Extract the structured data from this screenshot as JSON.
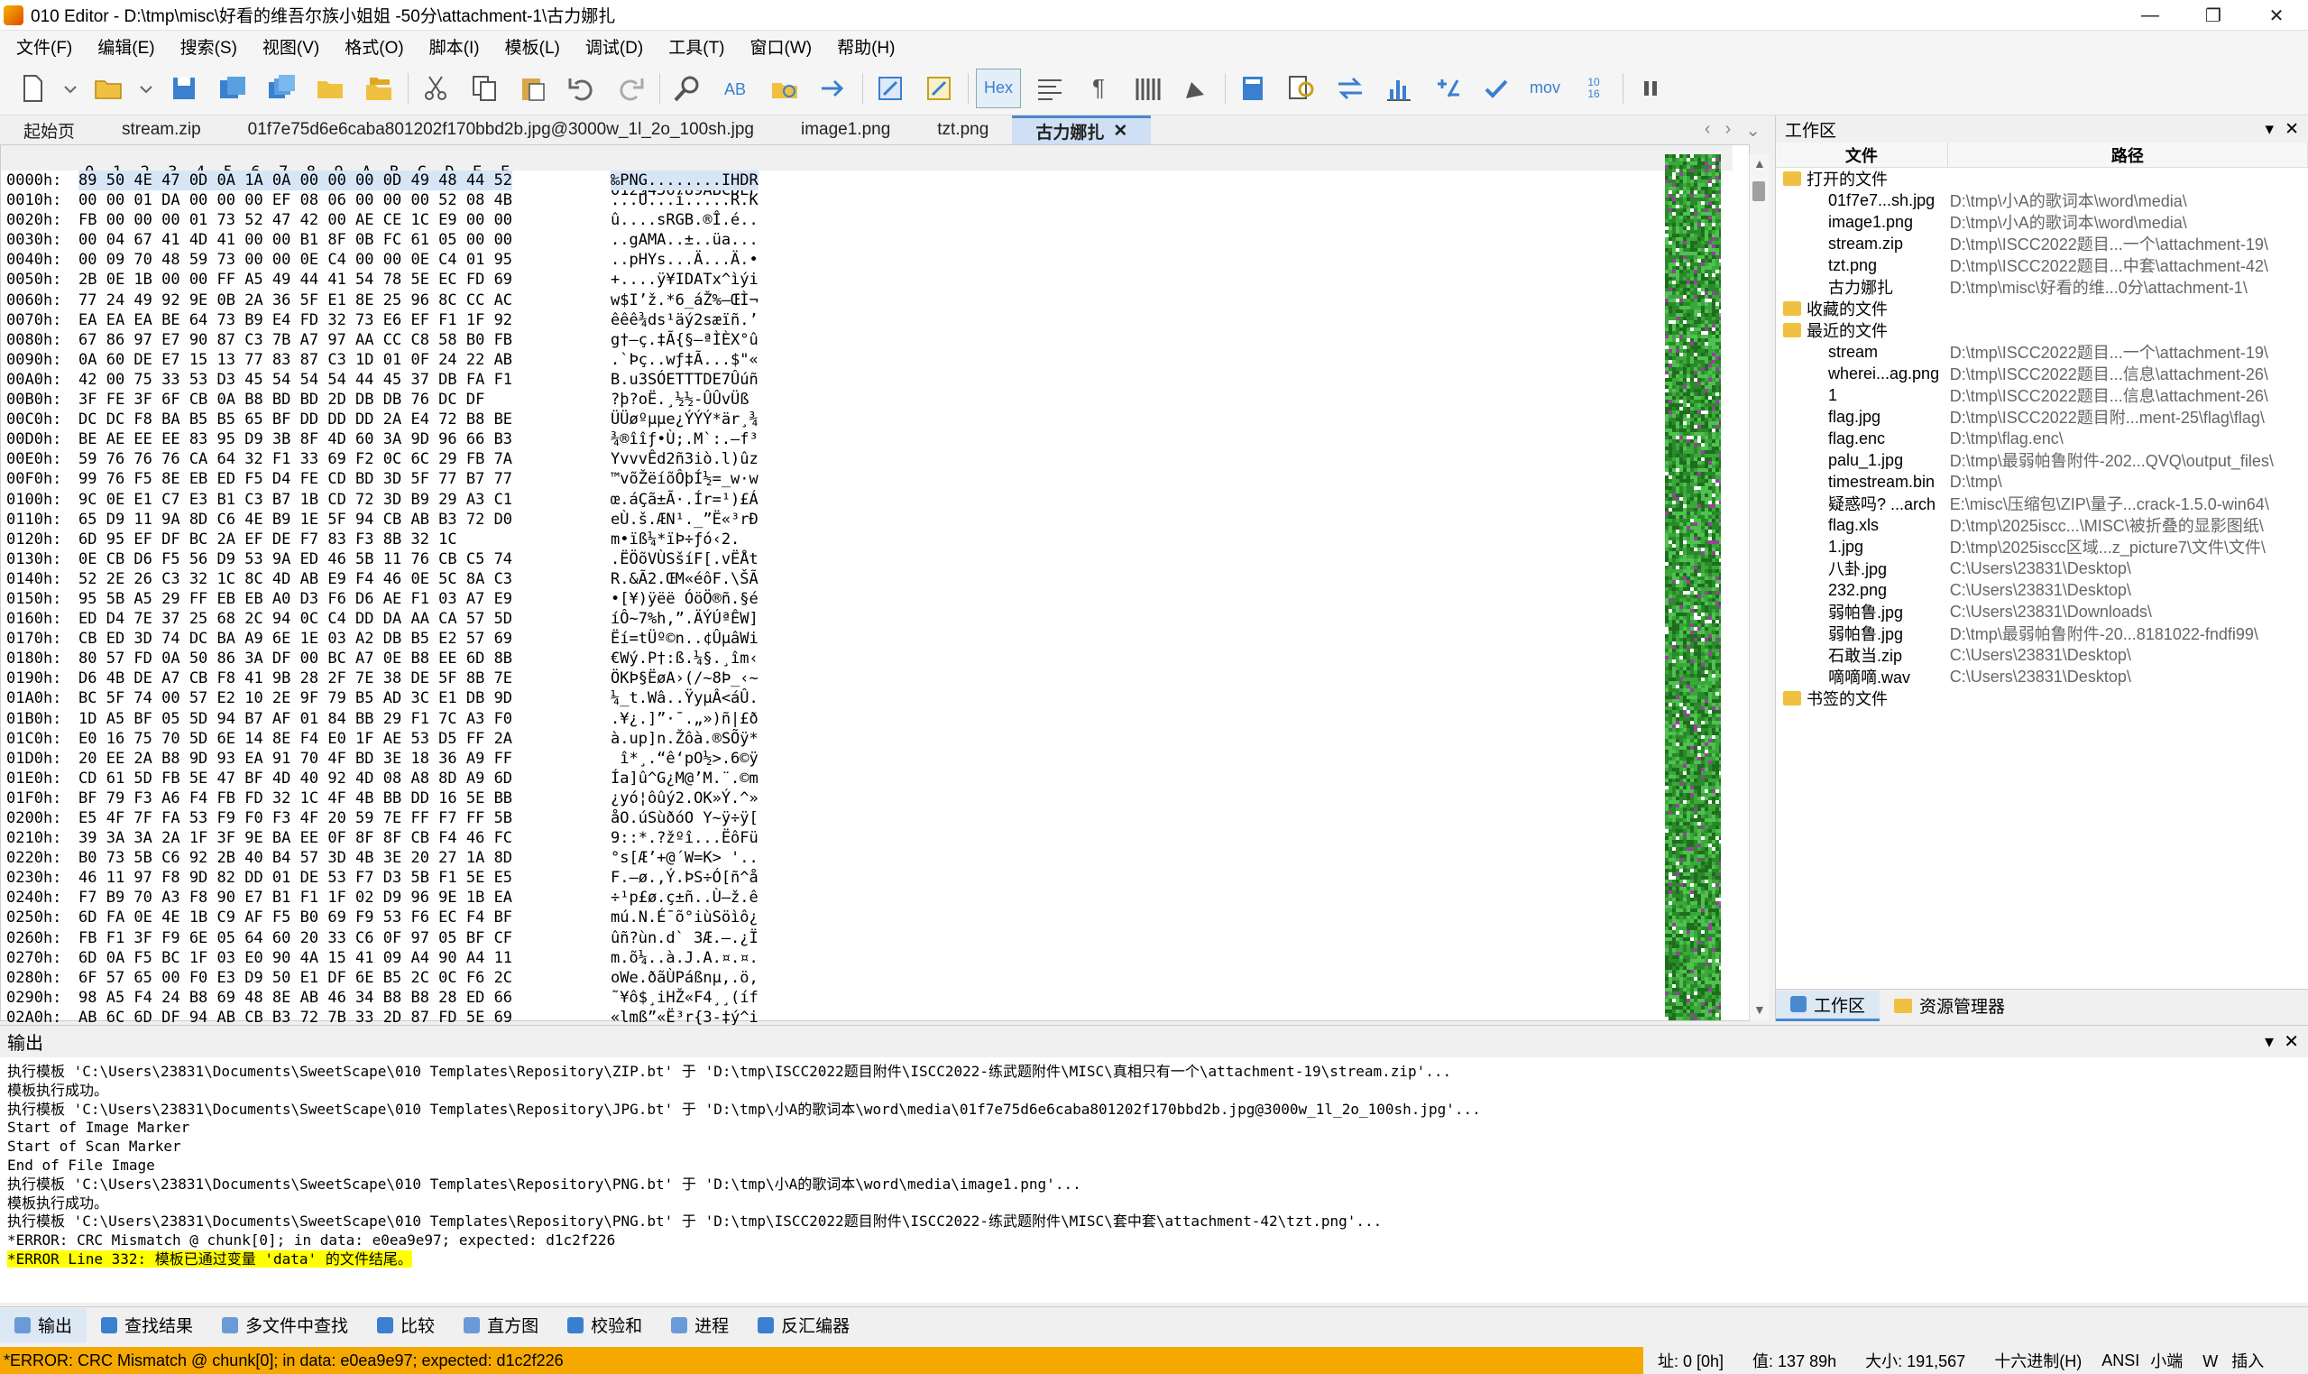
{
  "window": {
    "title": "010 Editor - D:\\tmp\\misc\\好看的维吾尔族小姐姐 -50分\\attachment-1\\古力娜扎"
  },
  "menu": [
    "文件(F)",
    "编辑(E)",
    "搜索(S)",
    "视图(V)",
    "格式(O)",
    "脚本(I)",
    "模板(L)",
    "调试(D)",
    "工具(T)",
    "窗口(W)",
    "帮助(H)"
  ],
  "toolbar": {
    "hex_label": "Hex",
    "mov_label": "mov",
    "num_label": "10 16"
  },
  "tabs": [
    "起始页",
    "stream.zip",
    "01f7e75d6e6caba801202f170bbd2b.jpg@3000w_1l_2o_100sh.jpg",
    "image1.png",
    "tzt.png",
    "古力娜扎"
  ],
  "active_tab": "古力娜扎",
  "hex": {
    "header_hex": "     0  1  2  3  4  5  6  7  8  9  A  B  C  D  E  F",
    "header_ascii": "0123456789ABCDEF",
    "rows": [
      {
        "o": "0000h:",
        "h": "89 50 4E 47 0D 0A 1A 0A 00 00 00 0D 49 48 44 52",
        "a": "‰PNG........IHDR"
      },
      {
        "o": "0010h:",
        "h": "00 00 01 DA 00 00 00 EF 08 06 00 00 00 52 08 4B",
        "a": "...Ú...ï.....R.K"
      },
      {
        "o": "0020h:",
        "h": "FB 00 00 00 01 73 52 47 42 00 AE CE 1C E9 00 00",
        "a": "û....sRGB.®Î.é.."
      },
      {
        "o": "0030h:",
        "h": "00 04 67 41 4D 41 00 00 B1 8F 0B FC 61 05 00 00",
        "a": "..gAMA..±..üa..."
      },
      {
        "o": "0040h:",
        "h": "00 09 70 48 59 73 00 00 0E C4 00 00 0E C4 01 95",
        "a": "..pHYs...Ä...Ä.•"
      },
      {
        "o": "0050h:",
        "h": "2B 0E 1B 00 00 FF A5 49 44 41 54 78 5E EC FD 69",
        "a": "+....ÿ¥IDATx^ìýi"
      },
      {
        "o": "0060h:",
        "h": "77 24 49 92 9E 0B 2A 36 5F E1 8E 25 96 8C CC AC",
        "a": "w$I’ž.*6_áŽ%–ŒÌ¬"
      },
      {
        "o": "0070h:",
        "h": "EA EA EA BE 64 73 B9 E4 FD 32 73 E6 EF F1 1F 92",
        "a": "êêê¾ds¹äý2sæïñ.’"
      },
      {
        "o": "0080h:",
        "h": "67 86 97 E7 90 87 C3 7B A7 97 AA CC C8 58 B0 FB",
        "a": "g†—ç.‡Ã{§—ªÌÈX°û"
      },
      {
        "o": "0090h:",
        "h": "0A 60 DE E7 15 13 77 83 87 C3 1D 01 0F 24 22 AB",
        "a": ".`Þç..wƒ‡Ã...$\"«"
      },
      {
        "o": "00A0h:",
        "h": "42 00 75 33 53 D3 45 54 54 54 44 45 37 DB FA F1",
        "a": "B.u3SÓETTTDE7Ûúñ"
      },
      {
        "o": "00B0h:",
        "h": "3F FE 3F 6F CB 0A B8 BD BD 2D DB DB 76 DC DF",
        "a": "?þ?oË.¸½½-ÛÛvÜß"
      },
      {
        "o": "00C0h:",
        "h": "DC DC F8 BA B5 B5 65 BF DD DD DD 2A E4 72 B8 BE",
        "a": "ÜÜøºµµe¿ÝÝÝ*är¸¾"
      },
      {
        "o": "00D0h:",
        "h": "BE AE EE EE 83 95 D9 3B 8F 4D 60 3A 9D 96 66 B3",
        "a": "¾®îîƒ•Ù;.M`:.–f³"
      },
      {
        "o": "00E0h:",
        "h": "59 76 76 76 CA 64 32 F1 33 69 F2 0C 6C 29 FB 7A",
        "a": "YvvvÊd2ñ3iò.l)ûz"
      },
      {
        "o": "00F0h:",
        "h": "99 76 F5 8E EB ED F5 D4 FE CD BD 3D 5F 77 B7 77",
        "a": "™võŽëíõÔþÍ½=_w·w"
      },
      {
        "o": "0100h:",
        "h": "9C 0E E1 C7 E3 B1 C3 B7 1B CD 72 3D B9 29 A3 C1",
        "a": "œ.áÇã±Ã·.Ír=¹)£Á"
      },
      {
        "o": "0110h:",
        "h": "65 D9 11 9A 8D C6 4E B9 1E 5F 94 CB AB B3 72 D0",
        "a": "eÙ.š.ÆN¹._”Ë«³rÐ"
      },
      {
        "o": "0120h:",
        "h": "6D 95 EF DF BC 2A EF DE F7 83 F3 8B 32 1C",
        "a": "m•ïß¼*ïÞ÷ƒó‹2."
      },
      {
        "o": "0130h:",
        "h": "0E CB D6 F5 56 D9 53 9A ED 46 5B 11 76 CB C5 74",
        "a": ".ËÖõVÙSšíF[.vËÅt"
      },
      {
        "o": "0140h:",
        "h": "52 2E 26 C3 32 1C 8C 4D AB E9 F4 46 0E 5C 8A C3",
        "a": "R.&Ã2.ŒM«éôF.\\ŠÃ"
      },
      {
        "o": "0150h:",
        "h": "95 5B A5 29 FF EB EB A0 D3 F6 D6 AE F1 03 A7 E9",
        "a": "•[¥)ÿëë ÓöÖ®ñ.§é"
      },
      {
        "o": "0160h:",
        "h": "ED D4 7E 37 25 68 2C 94 0C C4 DD DA AA CA 57 5D",
        "a": "íÔ~7%h,”.ÄÝÚªÊW]"
      },
      {
        "o": "0170h:",
        "h": "CB ED 3D 74 DC BA A9 6E 1E 03 A2 DB B5 E2 57 69",
        "a": "Ëí=tÜº©n..¢ÛµâWi"
      },
      {
        "o": "0180h:",
        "h": "80 57 FD 0A 50 86 3A DF 00 BC A7 0E B8 EE 6D 8B",
        "a": "€Wý.P†:ß.¼§.¸îm‹"
      },
      {
        "o": "0190h:",
        "h": "D6 4B DE A7 CB F8 41 9B 28 2F 7E 38 DE 5F 8B 7E",
        "a": "ÖKÞ§ËøA›(/~8Þ_‹~"
      },
      {
        "o": "01A0h:",
        "h": "BC 5F 74 00 57 E2 10 2E 9F 79 B5 AD 3C E1 DB 9D",
        "a": "¼_t.Wâ..ŸyµÂ<áÛ."
      },
      {
        "o": "01B0h:",
        "h": "1D A5 BF 05 5D 94 B7 AF 01 84 BB 29 F1 7C A3 F0",
        "a": ".¥¿.]”·¯.„»)ñ|£ð"
      },
      {
        "o": "01C0h:",
        "h": "E0 16 75 70 5D 6E 14 8E F4 E0 1F AE 53 D5 FF 2A",
        "a": "à.up]n.Žôà.®SÕÿ*"
      },
      {
        "o": "01D0h:",
        "h": "20 EE 2A B8 9D 93 EA 91 70 4F BD 3E 18 36 A9 FF",
        "a": " î*¸.“ê‘pO½>.6©ÿ"
      },
      {
        "o": "01E0h:",
        "h": "CD 61 5D FB 5E 47 BF 4D 40 92 4D 08 A8 8D A9 6D",
        "a": "Ía]û^G¿M@’M.¨.©m"
      },
      {
        "o": "01F0h:",
        "h": "BF 79 F3 A6 F4 FB FD 32 1C 4F 4B BB DD 16 5E BB",
        "a": "¿yó¦ôûý2.OK»Ý.^»"
      },
      {
        "o": "0200h:",
        "h": "E5 4F 7F FA 53 F9 F0 F3 4F 20 59 7E FF F7 FF 5B",
        "a": "åO.úSùðóO Y~ÿ÷ÿ["
      },
      {
        "o": "0210h:",
        "h": "39 3A 3A 2A 1F 3F 9E BA EE 0F 8F 8F CB F4 46 FC",
        "a": "9::*.?žºî...ËôFü"
      },
      {
        "o": "0220h:",
        "h": "B0 73 5B C6 92 2B 40 B4 57 3D 4B 3E 20 27 1A 8D",
        "a": "°s[Æ’+@´W=K> '.."
      },
      {
        "o": "0230h:",
        "h": "46 11 97 F8 9D 82 DD 01 DE 53 F7 D3 5B F1 5E E5",
        "a": "F.—ø.‚Ý.ÞS÷Ó[ñ^å"
      },
      {
        "o": "0240h:",
        "h": "F7 B9 70 A3 F8 90 E7 B1 F1 1F 02 D9 96 9E 1B EA",
        "a": "÷¹p£ø.ç±ñ..Ù–ž.ê"
      },
      {
        "o": "0250h:",
        "h": "6D FA 0E 4E 1B C9 AF F5 B0 69 F9 53 F6 EC F4 BF",
        "a": "mú.N.É¯õ°iùSöìô¿"
      },
      {
        "o": "0260h:",
        "h": "FB F1 3F F9 6E 05 64 60 20 33 C6 0F 97 05 BF CF",
        "a": "ûñ?ùn.d` 3Æ.—.¿Ï"
      },
      {
        "o": "0270h:",
        "h": "6D 0A F5 BC 1F 03 E0 90 4A 15 41 09 A4 90 A4 11",
        "a": "m.õ¼..à.J.A.¤.¤."
      },
      {
        "o": "0280h:",
        "h": "6F 57 65 00 F0 E3 D9 50 E1 DF 6E B5 2C 0C F6 2C",
        "a": "oWe.ðãÙPáßnµ,.ö,"
      },
      {
        "o": "0290h:",
        "h": "98 A5 F4 24 B8 69 48 8E AB 46 34 B8 B8 28 ED 66",
        "a": "˜¥ô$¸iHŽ«F4¸¸(íf"
      },
      {
        "o": "02A0h:",
        "h": "AB 6C 6D DF 94 AB CB B3 72 7B 33 2D 87 FD 5E 69",
        "a": "«lmß”«Ë³r{3-‡ý^i"
      }
    ]
  },
  "workspace": {
    "title": "工作区",
    "col_file": "文件",
    "col_path": "路径",
    "groups": [
      {
        "label": "打开的文件",
        "items": [
          {
            "name": "01f7e7...sh.jpg",
            "path": "D:\\tmp\\小A的歌词本\\word\\media\\"
          },
          {
            "name": "image1.png",
            "path": "D:\\tmp\\小A的歌词本\\word\\media\\"
          },
          {
            "name": "stream.zip",
            "path": "D:\\tmp\\ISCC2022题目...一个\\attachment-19\\"
          },
          {
            "name": "tzt.png",
            "path": "D:\\tmp\\ISCC2022题目...中套\\attachment-42\\"
          },
          {
            "name": "古力娜扎",
            "path": "D:\\tmp\\misc\\好看的维...0分\\attachment-1\\"
          }
        ]
      },
      {
        "label": "收藏的文件",
        "items": []
      },
      {
        "label": "最近的文件",
        "items": [
          {
            "name": "stream",
            "path": "D:\\tmp\\ISCC2022题目...一个\\attachment-19\\"
          },
          {
            "name": "wherei...ag.png",
            "path": "D:\\tmp\\ISCC2022题目...信息\\attachment-26\\"
          },
          {
            "name": "1",
            "path": "D:\\tmp\\ISCC2022题目...信息\\attachment-26\\"
          },
          {
            "name": "flag.jpg",
            "path": "D:\\tmp\\ISCC2022题目附...ment-25\\flag\\flag\\"
          },
          {
            "name": "flag.enc",
            "path": "D:\\tmp\\flag.enc\\"
          },
          {
            "name": "palu_1.jpg",
            "path": "D:\\tmp\\最弱帕鲁附件-202...QVQ\\output_files\\"
          },
          {
            "name": "timestream.bin",
            "path": "D:\\tmp\\"
          },
          {
            "name": "疑惑吗? ...arch",
            "path": "E:\\misc\\压缩包\\ZIP\\量子...crack-1.5.0-win64\\"
          },
          {
            "name": "flag.xls",
            "path": "D:\\tmp\\2025iscc...\\MISC\\被折叠的显影图纸\\"
          },
          {
            "name": "1.jpg",
            "path": "D:\\tmp\\2025iscc区域...z_picture7\\文件\\文件\\"
          },
          {
            "name": "八卦.jpg",
            "path": "C:\\Users\\23831\\Desktop\\"
          },
          {
            "name": "232.png",
            "path": "C:\\Users\\23831\\Desktop\\"
          },
          {
            "name": "弱帕鲁.jpg",
            "path": "C:\\Users\\23831\\Downloads\\"
          },
          {
            "name": "弱帕鲁.jpg",
            "path": "D:\\tmp\\最弱帕鲁附件-20...8181022-fndfi99\\"
          },
          {
            "name": "石敢当.zip",
            "path": "C:\\Users\\23831\\Desktop\\"
          },
          {
            "name": "嘀嘀嘀.wav",
            "path": "C:\\Users\\23831\\Desktop\\"
          }
        ]
      },
      {
        "label": "书签的文件",
        "items": []
      }
    ],
    "tabs": [
      "工作区",
      "资源管理器"
    ]
  },
  "output": {
    "title": "输出",
    "lines": [
      "执行模板 'C:\\Users\\23831\\Documents\\SweetScape\\010 Templates\\Repository\\ZIP.bt' 于 'D:\\tmp\\ISCC2022题目附件\\ISCC2022-练武题附件\\MISC\\真相只有一个\\attachment-19\\stream.zip'...",
      "模板执行成功。",
      "执行模板 'C:\\Users\\23831\\Documents\\SweetScape\\010 Templates\\Repository\\JPG.bt' 于 'D:\\tmp\\小A的歌词本\\word\\media\\01f7e75d6e6caba801202f170bbd2b.jpg@3000w_1l_2o_100sh.jpg'...",
      "Start of Image Marker",
      "Start of Scan Marker",
      "End of File Image",
      "执行模板 'C:\\Users\\23831\\Documents\\SweetScape\\010 Templates\\Repository\\PNG.bt' 于 'D:\\tmp\\小A的歌词本\\word\\media\\image1.png'...",
      "模板执行成功。",
      "执行模板 'C:\\Users\\23831\\Documents\\SweetScape\\010 Templates\\Repository\\PNG.bt' 于 'D:\\tmp\\ISCC2022题目附件\\ISCC2022-练武题附件\\MISC\\套中套\\attachment-42\\tzt.png'...",
      "*ERROR: CRC Mismatch @ chunk[0]; in data: e0ea9e97; expected: d1c2f226"
    ],
    "error_line": "*ERROR Line 332: 模板已通过变量 'data' 的文件结尾。"
  },
  "output_tabs": [
    "输出",
    "查找结果",
    "多文件中查找",
    "比较",
    "直方图",
    "校验和",
    "进程",
    "反汇编器"
  ],
  "status": {
    "error": "*ERROR: CRC Mismatch @ chunk[0]; in data: e0ea9e97; expected: d1c2f226",
    "addr": "址: 0 [0h]",
    "value": "值: 137 89h",
    "size": "大小: 191,567",
    "mode": "十六进制(H)",
    "encoding": "ANSI",
    "endian": "小端",
    "insert": "W   插入"
  },
  "colors": {
    "accent": "#4a88d0",
    "error_bar": "#f5a800",
    "highlight": "#ffff00",
    "minimap_green": "#3aa83a"
  }
}
